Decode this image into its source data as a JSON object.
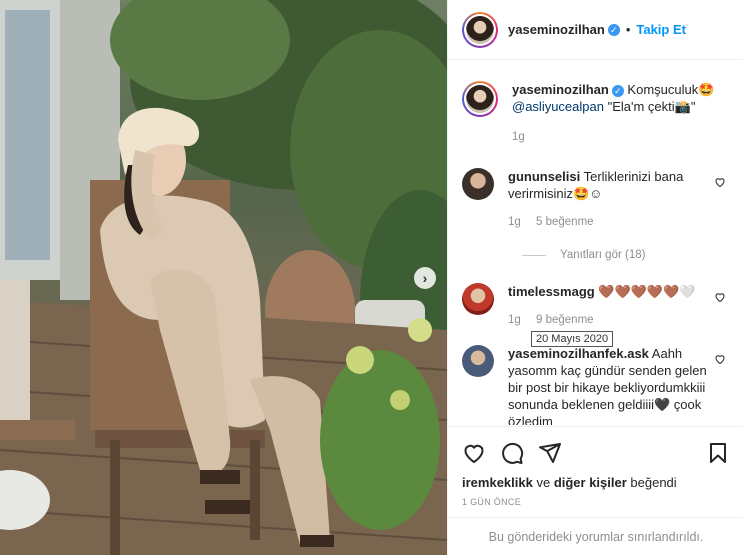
{
  "post": {
    "author": "yaseminozilhan",
    "follow_label": "Takip Et",
    "dot": "•"
  },
  "caption": {
    "author": "yaseminozilhan",
    "text_a": " Komşuculuk🤩",
    "mention": "@asliyucealpan",
    "text_b": " \"Ela'm çekti📸\"",
    "time": "1g"
  },
  "comments": [
    {
      "author": "gununselisi",
      "text": " Terliklerinizi bana verirmisiniz🤩☺",
      "time": "1g",
      "likes": "5 beğenme",
      "avatar_color": "#3a2f29"
    },
    {
      "author": "timelessmagg",
      "text": " 🤎🤎🤎🤎🤎🤍",
      "time": "1g",
      "likes": "9 beğenme",
      "avatar_color": "#c0392b"
    },
    {
      "author": "yaseminozilhanfek.ask",
      "text": " Aahh yasomm kaç gündür senden gelen bir post bir hikaye bekliyordumkkiii sonunda beklenen geldiiii🖤 çook özledim",
      "avatar_color": "#4a5b7a"
    }
  ],
  "replies_label": "Yanıtları gör (18)",
  "tooltip_date": "20 Mayıs 2020",
  "icons": [
    "heart-icon",
    "comment-icon",
    "share-icon",
    "bookmark-icon"
  ],
  "likes": {
    "user": "iremkeklikk",
    "middle": " ve ",
    "others": "diğer kişiler",
    "suffix": " beğendi"
  },
  "post_date": "1 GÜN ÖNCE",
  "comments_limited": "Bu gönderideki yorumlar sınırlandırıldı."
}
